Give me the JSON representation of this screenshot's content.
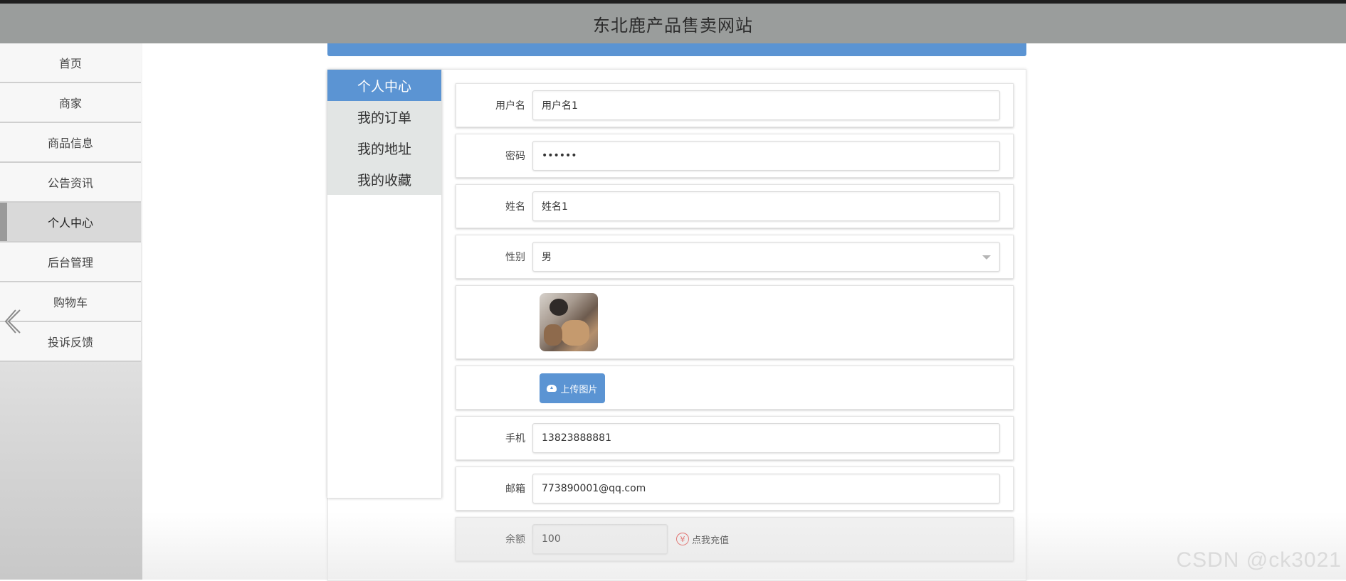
{
  "header": {
    "site_title": "东北鹿产品售卖网站"
  },
  "sidebar": {
    "items": [
      {
        "label": "首页",
        "active": false
      },
      {
        "label": "商家",
        "active": false
      },
      {
        "label": "商品信息",
        "active": false
      },
      {
        "label": "公告资讯",
        "active": false
      },
      {
        "label": "个人中心",
        "active": true
      },
      {
        "label": "后台管理",
        "active": false
      },
      {
        "label": "购物车",
        "active": false
      },
      {
        "label": "投诉反馈",
        "active": false
      }
    ],
    "collapse_icon": "chevron-left-icon"
  },
  "user_menu": {
    "items": [
      {
        "label": "个人中心",
        "active": true
      },
      {
        "label": "我的订单",
        "active": false
      },
      {
        "label": "我的地址",
        "active": false
      },
      {
        "label": "我的收藏",
        "active": false
      }
    ]
  },
  "form": {
    "username": {
      "label": "用户名",
      "value": "用户名1"
    },
    "password": {
      "label": "密码",
      "value": "••••••"
    },
    "name": {
      "label": "姓名",
      "value": "姓名1"
    },
    "gender": {
      "label": "性别",
      "value": "男"
    },
    "upload": {
      "label": "上传图片",
      "icon": "cloud-upload-icon"
    },
    "phone": {
      "label": "手机",
      "value": "13823888881"
    },
    "email": {
      "label": "邮箱",
      "value": "773890001@qq.com"
    },
    "balance": {
      "label": "余额",
      "value": "100",
      "recharge_label": "点我充值",
      "recharge_icon": "yen-icon"
    }
  },
  "watermark": "CSDN @ck3021",
  "colors": {
    "accent": "#5b94d3",
    "header_bg": "#9a9d9c",
    "recharge_icon": "#e0504d"
  }
}
